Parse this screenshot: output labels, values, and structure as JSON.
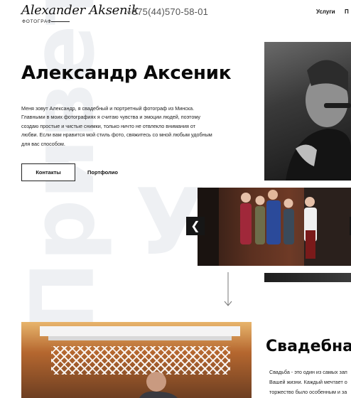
{
  "header": {
    "logo_name": "Alexander Aksenik",
    "logo_subtitle": "ФОТОГРАФ",
    "phone": "+375(44)570-58-01",
    "nav": [
      "Услуги",
      "П"
    ]
  },
  "background_words": {
    "vertical": "Привет",
    "horizontal": "У"
  },
  "hero": {
    "title": "Александр Аксеник",
    "description": "Меня зовут Александр, я свадебный и портретный фотограф из Минска. Главными в моих фотографиях я считаю чувства и эмоции людей, поэтому создаю простые и чистые снимки, только ничто не отвлекло внимания от любви. Если вам нравится мой стиль фото, свяжитесь со мной любым удобным для вас способом.",
    "contacts_button": "Контакты",
    "portfolio_link": "Портфолио"
  },
  "slider": {
    "prev_icon": "chevron-left-icon"
  },
  "wedding_section": {
    "title": "Свадебная",
    "text_lines": [
      "Свадьба - это один из самых зап",
      "Вашей жизни. Каждый мечтает о",
      "торжество было особенным и за"
    ]
  },
  "colors": {
    "accent": "#111111",
    "arrow_bg": "#161616",
    "watermark": "#eef0f3"
  }
}
